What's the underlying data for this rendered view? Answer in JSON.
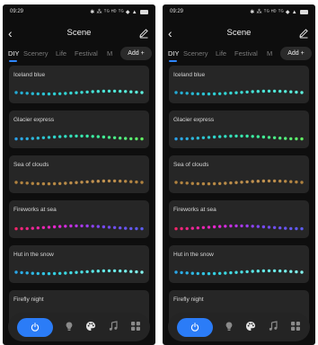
{
  "status": {
    "time": "09:29",
    "icons": "✱ ⁂ ᵀᴳ ᴴᴰ ᵀᴳ ◆ ▲"
  },
  "header": {
    "title": "Scene",
    "back_glyph": "‹"
  },
  "tabs": [
    {
      "label": "DIY",
      "active": true
    },
    {
      "label": "Scenery",
      "active": false
    },
    {
      "label": "Life",
      "active": false
    },
    {
      "label": "Festival",
      "active": false
    },
    {
      "label": "M",
      "active": false
    }
  ],
  "add_button": {
    "label": "Add +"
  },
  "scenes": [
    {
      "name": "Iceland blue",
      "colors": [
        "#23a9d4",
        "#2fd0d2",
        "#48e3d6",
        "#5ef0dd"
      ]
    },
    {
      "name": "Glacier express",
      "colors": [
        "#2a9ee6",
        "#2fd8c8",
        "#3ff09a",
        "#62f064"
      ]
    },
    {
      "name": "Sea of clouds",
      "colors": [
        "#b0823f",
        "#b88a46",
        "#c29352",
        "#b0823f"
      ]
    },
    {
      "name": "Fireworks at sea",
      "colors": [
        "#f0256a",
        "#e626d8",
        "#7a48f5",
        "#5b5cf0"
      ]
    },
    {
      "name": "Hut in the snow",
      "colors": [
        "#2aa6e8",
        "#35d3e0",
        "#5fe8e6",
        "#85f4ee"
      ]
    },
    {
      "name": "Firefly night",
      "colors": [
        "#5f6ef0",
        "#7d78f0",
        "#9185e8",
        "#6a78f0"
      ]
    }
  ],
  "nav": [
    {
      "name": "power",
      "active": true
    },
    {
      "name": "bulb",
      "active": false
    },
    {
      "name": "palette",
      "active": false
    },
    {
      "name": "music",
      "active": false
    },
    {
      "name": "grid",
      "active": false
    }
  ],
  "colors": {
    "accent": "#2b7cf7",
    "background": "#0e0e0e",
    "card": "#262626"
  }
}
